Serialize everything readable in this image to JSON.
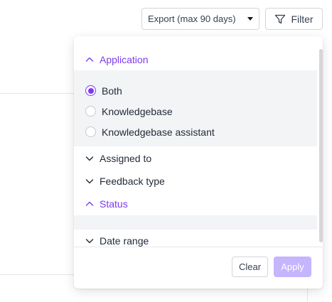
{
  "toolbar": {
    "export_label": "Export (max 90 days)",
    "export_icon": "caret-down-icon",
    "filter_label": "Filter",
    "filter_icon": "filter-funnel-icon"
  },
  "filter_panel": {
    "sections": [
      {
        "label": "Application",
        "expanded": true
      },
      {
        "label": "Assigned to",
        "expanded": false
      },
      {
        "label": "Feedback type",
        "expanded": false
      },
      {
        "label": "Status",
        "expanded": true
      },
      {
        "label": "Date range",
        "expanded": false
      }
    ],
    "application_options": [
      {
        "label": "Both",
        "selected": true
      },
      {
        "label": "Knowledgebase",
        "selected": false
      },
      {
        "label": "Knowledgebase assistant",
        "selected": false
      }
    ],
    "clear_label": "Clear",
    "apply_label": "Apply",
    "apply_disabled": true
  },
  "colors": {
    "accent": "#7c3aed",
    "accent_disabled": "#c4b5fd",
    "section_bg": "#f3f4f6",
    "border": "#d1d5db"
  }
}
